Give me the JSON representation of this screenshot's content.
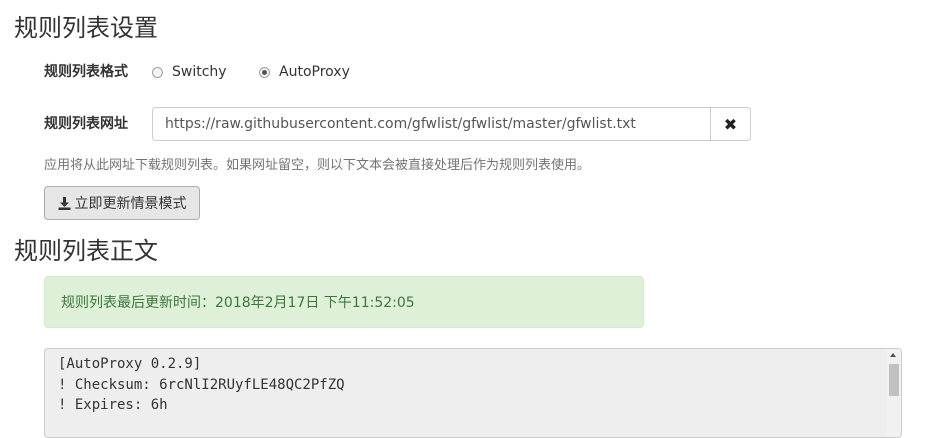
{
  "sections": {
    "rule_list_settings": "规则列表设置",
    "rule_list_body": "规则列表正文"
  },
  "format": {
    "label": "规则列表格式",
    "options": [
      "Switchy",
      "AutoProxy"
    ],
    "selected": "AutoProxy"
  },
  "url": {
    "label": "规则列表网址",
    "value": "https://raw.githubusercontent.com/gfwlist/gfwlist/master/gfwlist.txt",
    "clear_icon": "times-icon"
  },
  "help_text": "应用将从此网址下载规则列表。如果网址留空，则以下文本会被直接处理后作为规则列表使用。",
  "update_button": {
    "label": "立即更新情景模式",
    "icon": "download-icon"
  },
  "status": {
    "last_updated": "规则列表最后更新时间：2018年2月17日 下午11:52:05"
  },
  "rule_text": {
    "lines": [
      "[AutoProxy 0.2.9]",
      "! Checksum: 6rcNlI2RUyfLE48QC2PfZQ",
      "! Expires: 6h"
    ]
  }
}
